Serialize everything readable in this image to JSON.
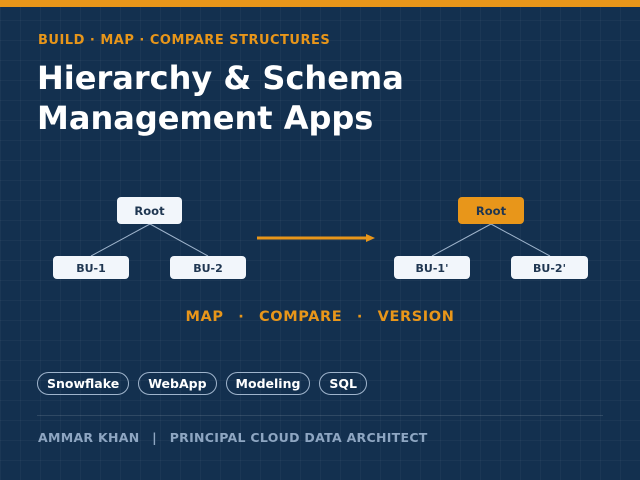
{
  "header": {
    "eyebrow": "BUILD · MAP · COMPARE STRUCTURES",
    "title_line1": "Hierarchy & Schema",
    "title_line2": "Management Apps"
  },
  "diagram": {
    "left_tree": {
      "root": "Root",
      "children": [
        "BU-1",
        "BU-2"
      ]
    },
    "right_tree": {
      "root": "Root",
      "children": [
        "BU-1'",
        "BU-2'"
      ]
    },
    "colors": {
      "node_fill": "#f2f6fb",
      "highlight_fill": "#e8961a",
      "arrow": "#e8961a",
      "connector": "#9fb4cc"
    }
  },
  "tagline": {
    "items": [
      "MAP",
      "COMPARE",
      "VERSION"
    ],
    "separator": "·"
  },
  "tags": [
    "Snowflake",
    "WebApp",
    "Modeling",
    "SQL"
  ],
  "footer": {
    "name": "AMMAR KHAN",
    "separator": "|",
    "role": "PRINCIPAL CLOUD DATA ARCHITECT"
  },
  "colors": {
    "background": "#13304f",
    "accent": "#e8961a",
    "title": "#ffffff",
    "muted": "#8ea6c2"
  }
}
